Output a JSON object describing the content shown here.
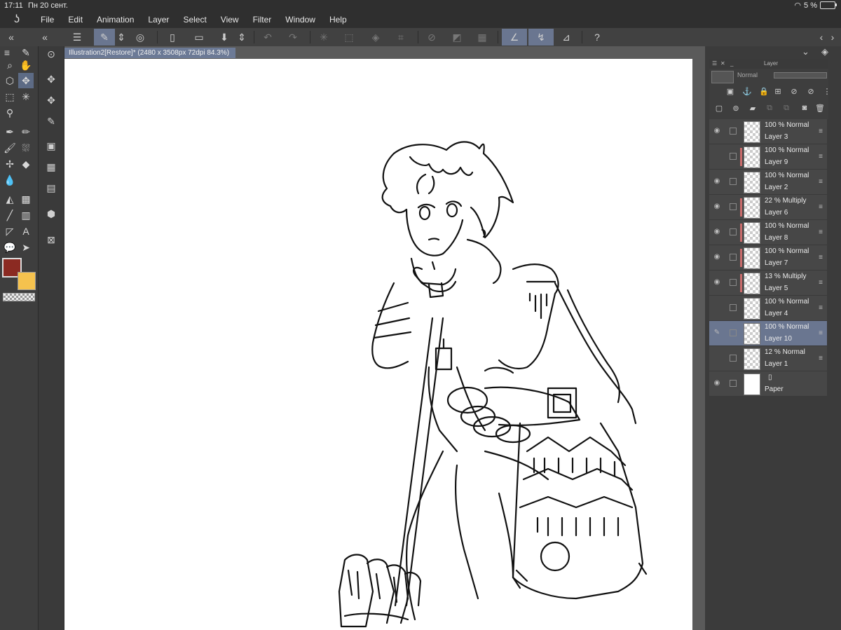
{
  "status": {
    "time": "17:11",
    "date": "Пн 20 сент.",
    "battery": "5 %"
  },
  "menu": [
    "File",
    "Edit",
    "Animation",
    "Layer",
    "Select",
    "View",
    "Filter",
    "Window",
    "Help"
  ],
  "document_tab": "Illustration2[Restore]* (2480 x 3508px 72dpi 84.3%)",
  "layer_panel": {
    "title": "Layer",
    "blend_mode": "Normal",
    "layers": [
      {
        "mode": "100 % Normal",
        "name": "Layer 3",
        "visible": true,
        "clipped": false,
        "selected": false
      },
      {
        "mode": "100 % Normal",
        "name": "Layer 9",
        "visible": false,
        "clipped": true,
        "selected": false
      },
      {
        "mode": "100 % Normal",
        "name": "Layer 2",
        "visible": true,
        "clipped": false,
        "selected": false
      },
      {
        "mode": "22 % Multiply",
        "name": "Layer 6",
        "visible": true,
        "clipped": true,
        "selected": false
      },
      {
        "mode": "100 % Normal",
        "name": "Layer 8",
        "visible": true,
        "clipped": true,
        "selected": false
      },
      {
        "mode": "100 % Normal",
        "name": "Layer 7",
        "visible": true,
        "clipped": true,
        "selected": false
      },
      {
        "mode": "13 % Multiply",
        "name": "Layer 5",
        "visible": true,
        "clipped": true,
        "selected": false
      },
      {
        "mode": "100 % Normal",
        "name": "Layer 4",
        "visible": false,
        "clipped": false,
        "selected": false
      },
      {
        "mode": "100 % Normal",
        "name": "Layer 10",
        "visible": false,
        "clipped": false,
        "selected": true
      },
      {
        "mode": "12 % Normal",
        "name": "Layer 1",
        "visible": false,
        "clipped": false,
        "selected": false
      },
      {
        "mode": "",
        "name": "Paper",
        "visible": true,
        "clipped": false,
        "selected": false
      }
    ]
  },
  "colors": {
    "main": "#8b2a22",
    "sub": "#f5c24e",
    "accent": "#6a7690"
  }
}
